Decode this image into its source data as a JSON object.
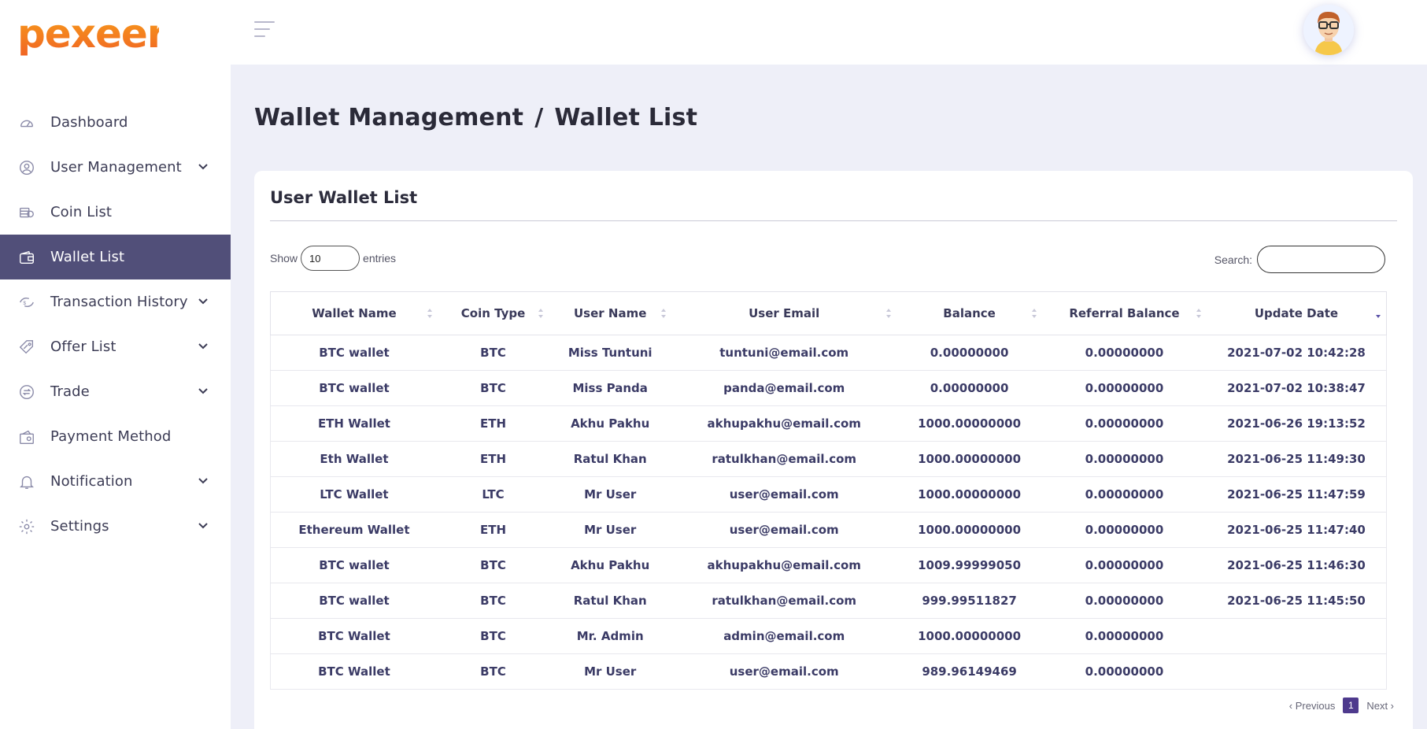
{
  "brand": {
    "logo_text": "pexeer",
    "accent": "#f5841f",
    "active_bg": "#514f79"
  },
  "sidebar": {
    "items": [
      {
        "label": "Dashboard",
        "icon": "gauge-icon",
        "expandable": false,
        "active": false
      },
      {
        "label": "User Management",
        "icon": "user-circle-icon",
        "expandable": true,
        "active": false
      },
      {
        "label": "Coin List",
        "icon": "coins-icon",
        "expandable": false,
        "active": false
      },
      {
        "label": "Wallet List",
        "icon": "wallet-icon",
        "expandable": false,
        "active": true
      },
      {
        "label": "Transaction History",
        "icon": "transaction-icon",
        "expandable": true,
        "active": false
      },
      {
        "label": "Offer List",
        "icon": "offer-tag-icon",
        "expandable": true,
        "active": false
      },
      {
        "label": "Trade",
        "icon": "exchange-icon",
        "expandable": true,
        "active": false
      },
      {
        "label": "Payment Method",
        "icon": "payment-icon",
        "expandable": false,
        "active": false
      },
      {
        "label": "Notification",
        "icon": "bell-icon",
        "expandable": true,
        "active": false
      },
      {
        "label": "Settings",
        "icon": "gear-icon",
        "expandable": true,
        "active": false
      }
    ]
  },
  "breadcrumb": {
    "section": "Wallet Management",
    "separator": "/",
    "page": "Wallet List"
  },
  "card": {
    "title": "User Wallet List",
    "show_label": "Show",
    "entries_value": "10",
    "entries_label": "entries",
    "search_label": "Search:",
    "search_placeholder": ""
  },
  "table": {
    "headers": [
      "Wallet Name",
      "Coin Type",
      "User Name",
      "User Email",
      "Balance",
      "Referral Balance",
      "Update Date"
    ],
    "rows": [
      [
        "BTC wallet",
        "BTC",
        "Miss Tuntuni",
        "tuntuni@email.com",
        "0.00000000",
        "0.00000000",
        "2021-07-02 10:42:28"
      ],
      [
        "BTC wallet",
        "BTC",
        "Miss Panda",
        "panda@email.com",
        "0.00000000",
        "0.00000000",
        "2021-07-02 10:38:47"
      ],
      [
        "ETH Wallet",
        "ETH",
        "Akhu Pakhu",
        "akhupakhu@email.com",
        "1000.00000000",
        "0.00000000",
        "2021-06-26 19:13:52"
      ],
      [
        "Eth Wallet",
        "ETH",
        "Ratul Khan",
        "ratulkhan@email.com",
        "1000.00000000",
        "0.00000000",
        "2021-06-25 11:49:30"
      ],
      [
        "LTC Wallet",
        "LTC",
        "Mr User",
        "user@email.com",
        "1000.00000000",
        "0.00000000",
        "2021-06-25 11:47:59"
      ],
      [
        "Ethereum Wallet",
        "ETH",
        "Mr User",
        "user@email.com",
        "1000.00000000",
        "0.00000000",
        "2021-06-25 11:47:40"
      ],
      [
        "BTC wallet",
        "BTC",
        "Akhu Pakhu",
        "akhupakhu@email.com",
        "1009.99999050",
        "0.00000000",
        "2021-06-25 11:46:30"
      ],
      [
        "BTC wallet",
        "BTC",
        "Ratul Khan",
        "ratulkhan@email.com",
        "999.99511827",
        "0.00000000",
        "2021-06-25 11:45:50"
      ],
      [
        "BTC Wallet",
        "BTC",
        "Mr. Admin",
        "admin@email.com",
        "1000.00000000",
        "0.00000000",
        ""
      ],
      [
        "BTC Wallet",
        "BTC",
        "Mr User",
        "user@email.com",
        "989.96149469",
        "0.00000000",
        ""
      ]
    ]
  },
  "pagination": {
    "previous": "‹ Previous",
    "current": "1",
    "next": "Next ›"
  }
}
